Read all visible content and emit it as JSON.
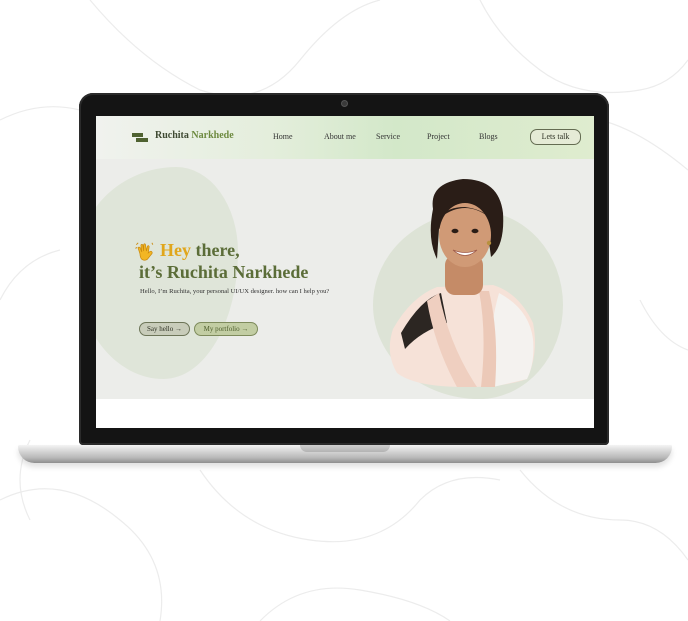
{
  "site": {
    "brand_first": "Ruchita ",
    "brand_last": "Narkhede",
    "nav": [
      "Home",
      "About me",
      "Service",
      "Project",
      "Blogs"
    ],
    "cta_label": "Lets talk"
  },
  "hero": {
    "greeting_accent": "Hey",
    "greeting_rest": " there,",
    "headline": "it’s Ruchita Narkhede",
    "intro": "Hello, I’m Ruchita, your personal UI/UX designer. how can I help you?",
    "buttons": [
      {
        "label": "Say hello →"
      },
      {
        "label": "My portfolio →"
      }
    ],
    "wave_icon": "waving-hand-icon"
  },
  "colors": {
    "brand_green": "#5b6d38",
    "accent_yellow": "#e0a61c",
    "header_green": "#d3e8c9",
    "hero_bg": "#ecedea"
  }
}
